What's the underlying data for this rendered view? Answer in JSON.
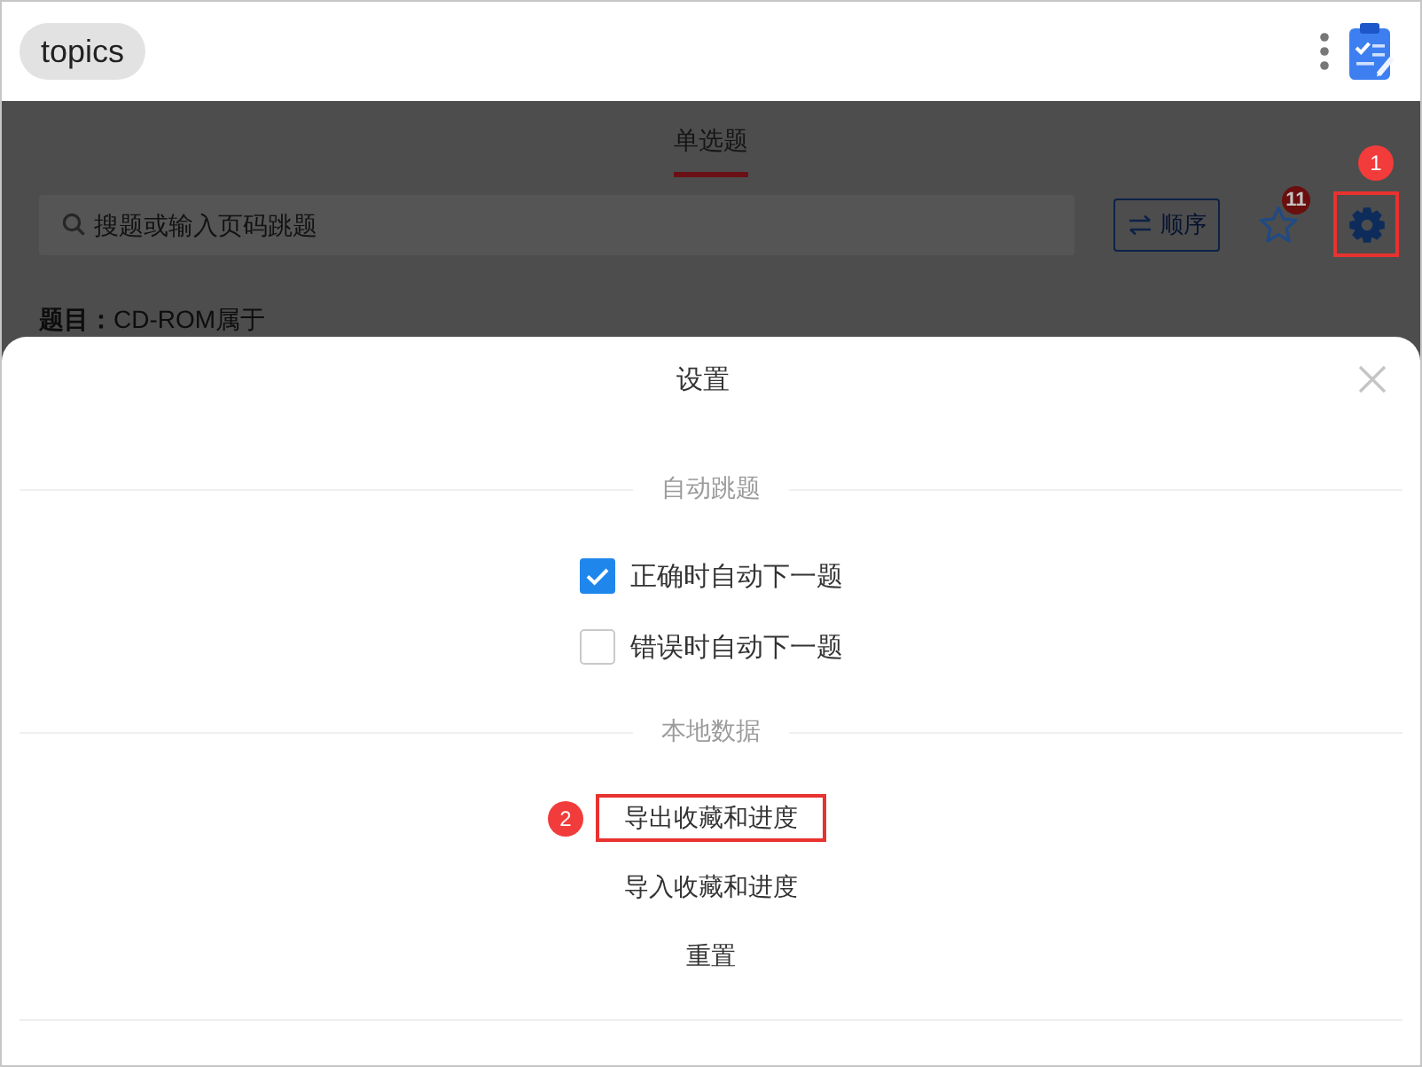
{
  "app_bar": {
    "title": "topics"
  },
  "page": {
    "tabs": [
      {
        "label": "单选题",
        "selected": true
      }
    ],
    "search": {
      "placeholder": "搜题或输入页码跳题"
    },
    "order_button": {
      "label": "顺序"
    },
    "favorites": {
      "count": "11"
    },
    "settings_button": {
      "annotation": "1"
    },
    "question": "**题目：**CD-ROM属于"
  },
  "settings": {
    "title": "设置",
    "sections": [
      {
        "heading": "自动跳题",
        "items": [
          {
            "kind": "checkbox",
            "label": "正确时自动下一题",
            "checked": true
          },
          {
            "kind": "checkbox",
            "label": "错误时自动下一题",
            "checked": false
          }
        ]
      },
      {
        "heading": "本地数据",
        "items": [
          {
            "kind": "action",
            "label": "导出收藏和进度",
            "annotation": "2"
          },
          {
            "kind": "action",
            "label": "导入收藏和进度"
          },
          {
            "kind": "action",
            "label": "重置"
          }
        ]
      }
    ]
  }
}
